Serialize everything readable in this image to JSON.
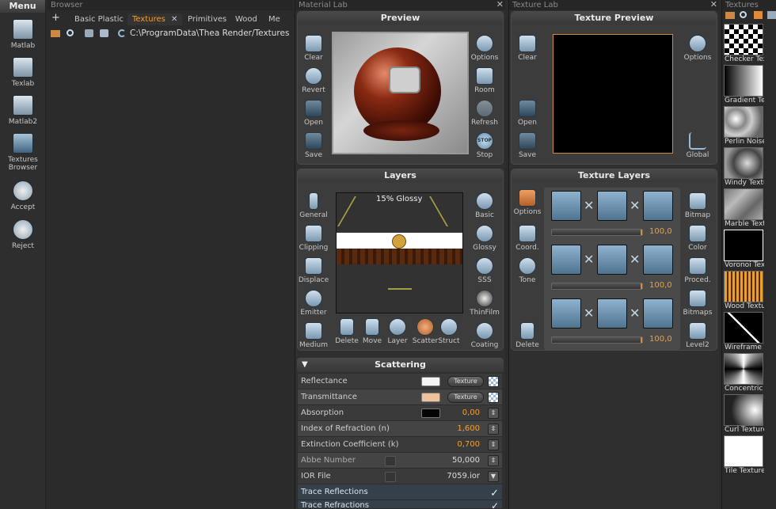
{
  "menu": {
    "title": "Menu",
    "items": [
      {
        "label": "Matlab",
        "icon": "matlab-icon"
      },
      {
        "label": "Texlab",
        "icon": "texlab-icon"
      },
      {
        "label": "Matlab2",
        "icon": "matlab2-icon"
      },
      {
        "label": "Textures Browser",
        "icon": "textures-browser-icon"
      },
      {
        "label": "Accept",
        "icon": "accept-icon"
      },
      {
        "label": "Reject",
        "icon": "reject-icon"
      }
    ]
  },
  "browser": {
    "title": "Browser",
    "add_label": "+",
    "tabs": [
      {
        "label": "Basic Plastic",
        "active": false
      },
      {
        "label": "Textures",
        "active": true
      },
      {
        "label": "Primitives",
        "active": false
      },
      {
        "label": "Wood",
        "active": false
      },
      {
        "label": "Me",
        "active": false
      }
    ],
    "tab_close": "✕",
    "path": "C:\\ProgramData\\Thea Render/Textures"
  },
  "material_lab": {
    "title": "Material Lab",
    "close": "✕",
    "preview": {
      "title": "Preview",
      "left_buttons": [
        {
          "label": "Clear",
          "icon": "clear-icon"
        },
        {
          "label": "Revert",
          "icon": "revert-icon"
        },
        {
          "label": "Open",
          "icon": "open-icon"
        },
        {
          "label": "Save",
          "icon": "save-icon"
        }
      ],
      "right_buttons": [
        {
          "label": "Options",
          "icon": "options-icon"
        },
        {
          "label": "Room",
          "icon": "room-icon"
        },
        {
          "label": "Refresh",
          "icon": "refresh-icon"
        },
        {
          "label": "Stop",
          "icon": "stop-icon"
        }
      ],
      "stop_text": "STOP"
    },
    "layers": {
      "title": "Layers",
      "left_buttons": [
        {
          "label": "General",
          "icon": "general-icon"
        },
        {
          "label": "Clipping",
          "icon": "clipping-icon"
        },
        {
          "label": "Displace",
          "icon": "displace-icon"
        },
        {
          "label": "Emitter",
          "icon": "emitter-icon"
        },
        {
          "label": "Medium",
          "icon": "medium-icon"
        }
      ],
      "right_buttons": [
        {
          "label": "Basic",
          "icon": "basic-icon"
        },
        {
          "label": "Glossy",
          "icon": "glossy-icon"
        },
        {
          "label": "SSS",
          "icon": "sss-icon"
        },
        {
          "label": "ThinFilm",
          "icon": "thinfilm-icon"
        },
        {
          "label": "Coating",
          "icon": "coating-icon"
        }
      ],
      "bottom_buttons": [
        {
          "label": "Delete",
          "icon": "delete-icon"
        },
        {
          "label": "Move",
          "icon": "move-icon"
        },
        {
          "label": "Layer",
          "icon": "layer-icon"
        },
        {
          "label": "Scatter",
          "icon": "scatter-icon"
        },
        {
          "label": "Struct",
          "icon": "struct-icon"
        }
      ],
      "layer_label": "15% Glossy"
    },
    "scattering": {
      "title": "Scattering",
      "collapse": "▼",
      "rows": [
        {
          "label": "Reflectance",
          "kind": "color",
          "color": "#f4f4f4",
          "button": "Texture"
        },
        {
          "label": "Transmittance",
          "kind": "color",
          "color": "#f0c29c",
          "button": "Texture"
        },
        {
          "label": "Absorption",
          "kind": "colorval",
          "color": "#050505",
          "value": "0,00"
        },
        {
          "label": "Index of Refraction (n)",
          "kind": "value",
          "value": "1,600"
        },
        {
          "label": "Extinction Coefficient (k)",
          "kind": "value",
          "value": "0,700"
        },
        {
          "label": "Abbe Number",
          "kind": "checkval",
          "value": "50,000"
        },
        {
          "label": "IOR File",
          "kind": "checkval",
          "value": "7059.ior"
        },
        {
          "label": "Trace Reflections",
          "kind": "check",
          "checked": true
        },
        {
          "label": "Trace Refractions",
          "kind": "check",
          "checked": true
        }
      ]
    }
  },
  "texture_lab": {
    "title": "Texture Lab",
    "close": "✕",
    "preview": {
      "title": "Texture Preview",
      "left_buttons": [
        {
          "label": "Clear",
          "icon": "clear-icon"
        },
        {
          "label": "Open",
          "icon": "open-icon"
        },
        {
          "label": "Save",
          "icon": "save-icon"
        }
      ],
      "right_buttons": [
        {
          "label": "Options",
          "icon": "options-icon"
        },
        {
          "label": "Global",
          "icon": "global-icon"
        }
      ]
    },
    "layers": {
      "title": "Texture Layers",
      "left_buttons": [
        {
          "label": "Options",
          "icon": "options-icon"
        },
        {
          "label": "Coord.",
          "icon": "coord-icon"
        },
        {
          "label": "Tone",
          "icon": "tone-icon"
        },
        {
          "label": "Delete",
          "icon": "delete-icon"
        }
      ],
      "right_buttons": [
        {
          "label": "Bitmap",
          "icon": "bitmap-icon"
        },
        {
          "label": "Color",
          "icon": "color-icon"
        },
        {
          "label": "Proced.",
          "icon": "procedural-icon"
        },
        {
          "label": "Bitmaps",
          "icon": "bitmaps-icon"
        },
        {
          "label": "Level2",
          "icon": "level2-icon"
        }
      ],
      "rows": [
        {
          "value": "100,0",
          "fraction": 1.0
        },
        {
          "value": "100,0",
          "fraction": 1.0
        },
        {
          "value": "100,0",
          "fraction": 1.0
        }
      ],
      "multiply": "✕"
    }
  },
  "textures": {
    "title": "Textures",
    "items": [
      {
        "label": "Checker Texture"
      },
      {
        "label": "Gradient Texture"
      },
      {
        "label": "Perlin Noise"
      },
      {
        "label": "Windy Texture"
      },
      {
        "label": "Marble Texture"
      },
      {
        "label": "Voronoi Texture"
      },
      {
        "label": "Wood Texture"
      },
      {
        "label": "Wireframe Texture"
      },
      {
        "label": "Concentric Texture"
      },
      {
        "label": "Curl Texture"
      },
      {
        "label": "Tile Texture"
      }
    ]
  }
}
